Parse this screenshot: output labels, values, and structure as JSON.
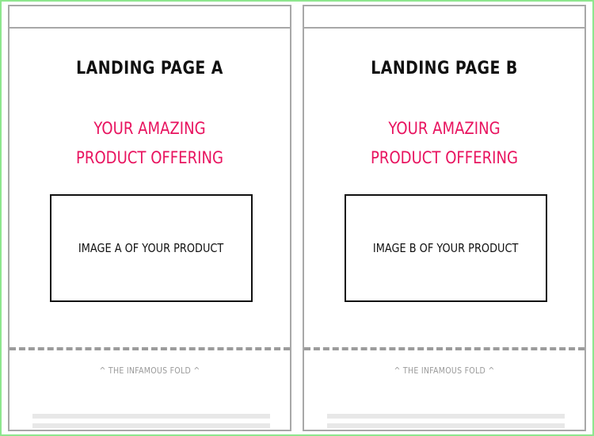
{
  "variants": [
    {
      "title": "LANDING PAGE A",
      "headline": [
        "YOUR AMAZING",
        "PRODUCT OFFERING"
      ],
      "image_label": "IMAGE A OF YOUR PRODUCT",
      "fold_label": "^ THE INFAMOUS FOLD ^"
    },
    {
      "title": "LANDING PAGE B",
      "headline": [
        "YOUR AMAZING",
        "PRODUCT OFFERING"
      ],
      "image_label": "IMAGE B OF YOUR PRODUCT",
      "fold_label": "^ THE INFAMOUS FOLD ^"
    }
  ],
  "colors": {
    "outer_border": "#8ee68e",
    "frame_border": "#a8a8a8",
    "headline": "#e8135f",
    "text": "#111111",
    "fold": "#9c9c9c",
    "placeholder": "#e8e8e8"
  }
}
